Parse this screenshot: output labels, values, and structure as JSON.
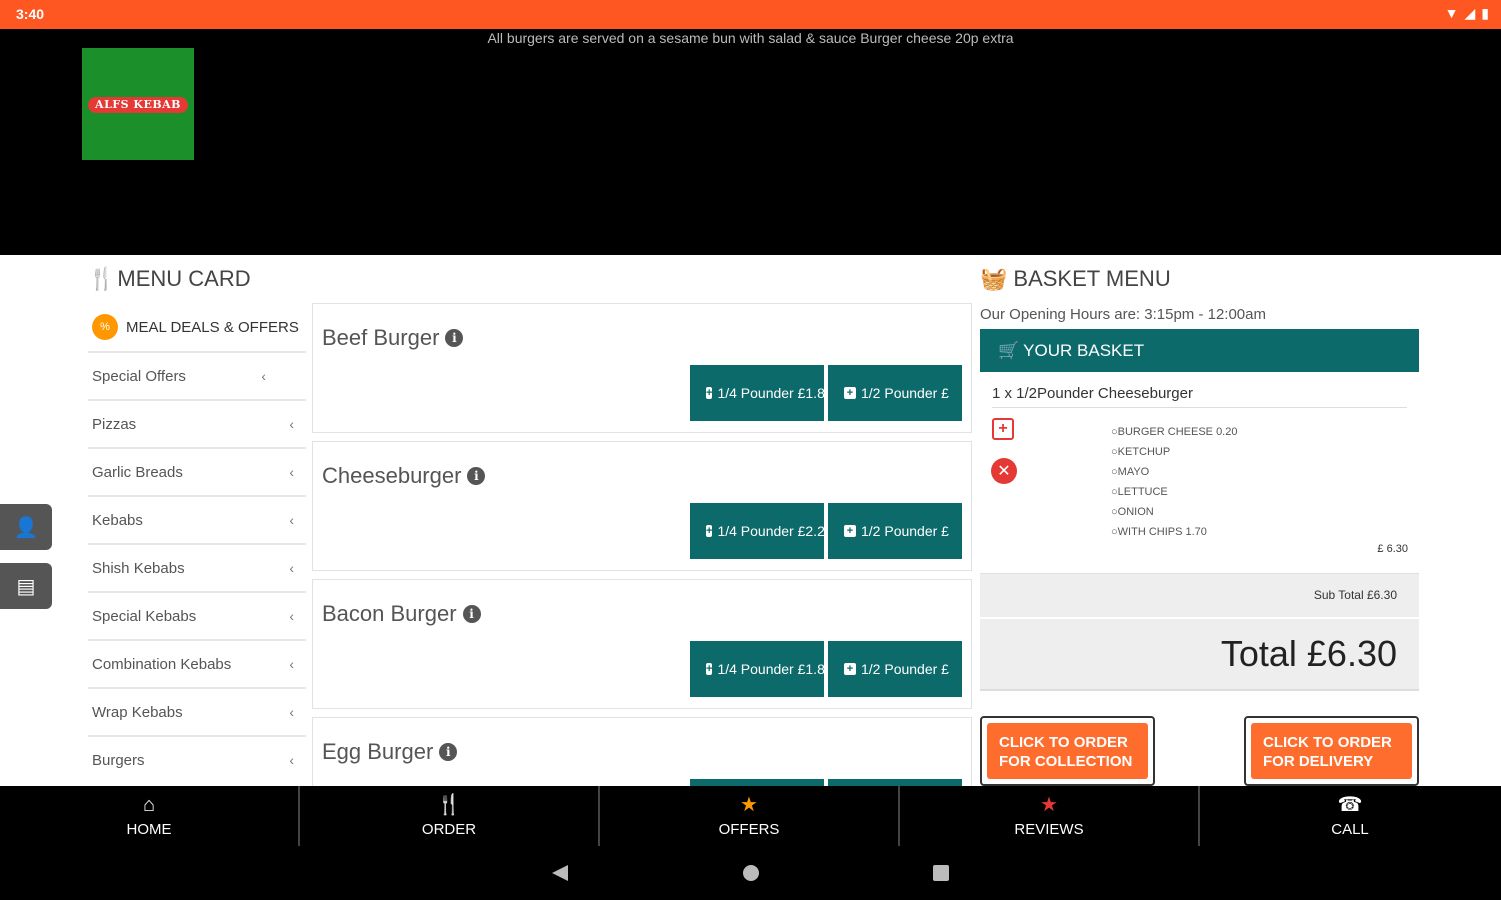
{
  "status_bar": {
    "time": "3:40",
    "wifi_icon": "wifi-icon",
    "signal_icon": "signal-icon",
    "battery_icon": "battery-icon"
  },
  "header": {
    "notice": "All burgers are served on a sesame bun with salad & sauce Burger cheese 20p extra",
    "logo_text": "ALFS KEBAB",
    "logo_bg": "#1a8f2a"
  },
  "side_tabs": [
    {
      "icon": "user-icon"
    },
    {
      "icon": "contact-card-icon"
    }
  ],
  "menu_card": {
    "title": "MENU CARD",
    "meal_deals": {
      "badge": "%",
      "label": "MEAL DEALS & OFFERS"
    },
    "categories": [
      {
        "label": "Special Offers"
      },
      {
        "label": "Pizzas"
      },
      {
        "label": "Garlic Breads"
      },
      {
        "label": "Kebabs"
      },
      {
        "label": "Shish Kebabs"
      },
      {
        "label": "Special Kebabs"
      },
      {
        "label": "Combination Kebabs"
      },
      {
        "label": "Wrap Kebabs"
      },
      {
        "label": "Burgers"
      }
    ],
    "chevron": "‹"
  },
  "products": [
    {
      "name": "Beef Burger",
      "opt1": "1/4 Pounder £1.80",
      "opt2": "1/2 Pounder £"
    },
    {
      "name": "Cheeseburger",
      "opt1": "1/4 Pounder £2.20",
      "opt2": "1/2 Pounder £"
    },
    {
      "name": "Bacon Burger",
      "opt1": "1/4 Pounder £1.80",
      "opt2": "1/2 Pounder £"
    },
    {
      "name": "Egg Burger",
      "opt1": "",
      "opt2": ""
    }
  ],
  "basket": {
    "title": "BASKET MENU",
    "hours": "Our Opening Hours are: 3:15pm - 12:00am",
    "header": "YOUR BASKET",
    "item": "1 x 1/2Pounder Cheeseburger",
    "extras": [
      "BURGER CHEESE 0.20",
      "KETCHUP",
      "MAYO",
      "LETTUCE",
      "ONION",
      "WITH CHIPS 1.70"
    ],
    "item_price": "£ 6.30",
    "subtotal": "Sub Total £6.30",
    "total": "Total £6.30",
    "collection_line1": "CLICK TO ORDER",
    "collection_line2": "FOR COLLECTION",
    "delivery_line1": "CLICK TO ORDER",
    "delivery_line2": "FOR DELIVERY",
    "accent": "#0d6a6a",
    "order_color": "#ff6d2e"
  },
  "bottom_nav": [
    {
      "label": "HOME",
      "icon": "home-icon"
    },
    {
      "label": "ORDER",
      "icon": "cutlery-icon"
    },
    {
      "label": "OFFERS",
      "icon": "star-icon"
    },
    {
      "label": "REVIEWS",
      "icon": "star-icon"
    },
    {
      "label": "CALL",
      "icon": "phone-icon"
    }
  ],
  "system_nav": [
    "back-icon",
    "home-circle-icon",
    "recents-icon"
  ],
  "colors": {
    "status_bar": "#ff5722",
    "offers_star": "#ff9800",
    "reviews_star": "#e53935"
  }
}
